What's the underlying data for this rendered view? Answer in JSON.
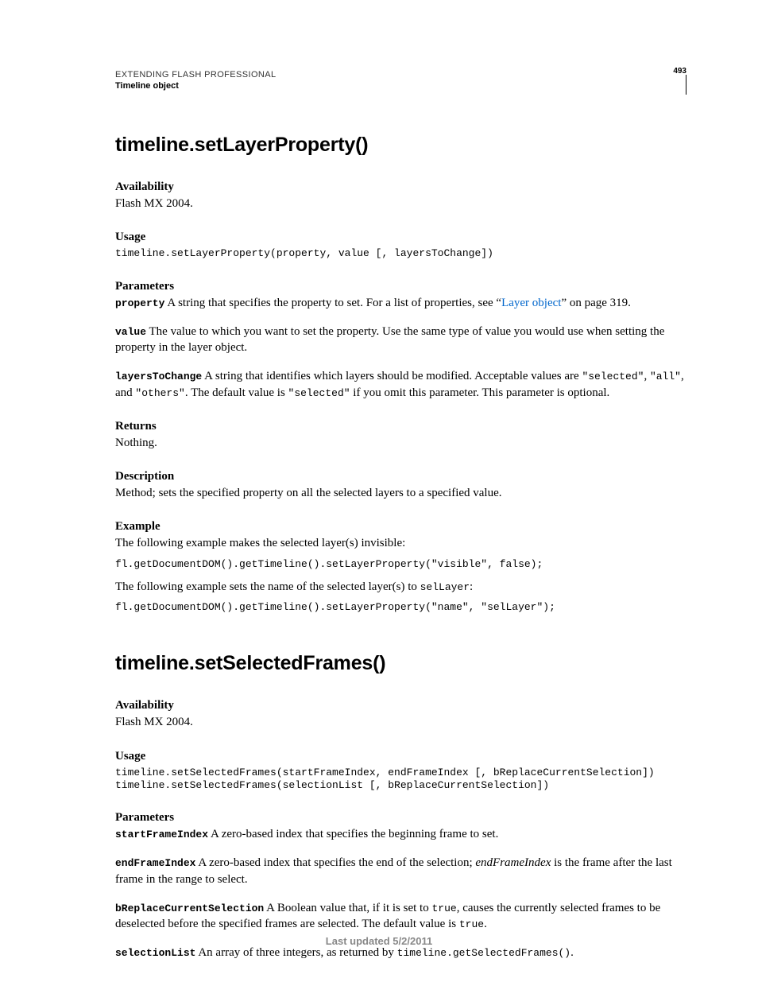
{
  "header": {
    "running1": "EXTENDING FLASH PROFESSIONAL",
    "running2": "Timeline object",
    "pageNumber": "493"
  },
  "s1": {
    "title": "timeline.setLayerProperty()",
    "availability_h": "Availability",
    "availability_t": "Flash MX 2004.",
    "usage_h": "Usage",
    "usage_code": "timeline.setLayerProperty(property, value [, layersToChange])",
    "parameters_h": "Parameters",
    "p1_name": "property",
    "p1_txt_a": "  A string that specifies the property to set. For a list of properties, see “",
    "p1_link": "Layer object",
    "p1_txt_b": "” on page 319.",
    "p2_name": "value",
    "p2_txt": "  The value to which you want to set the property. Use the same type of value you would use when setting the property in the layer object.",
    "p3_name": "layersToChange",
    "p3_txt_a": "  A string that identifies which layers should be modified. Acceptable values are ",
    "p3_c1": "\"selected\"",
    "p3_comma1": ", ",
    "p3_c2": "\"all\"",
    "p3_comma2": ", and ",
    "p3_c3": "\"others\"",
    "p3_txt_b": ". The default value is ",
    "p3_c4": "\"selected\"",
    "p3_txt_c": " if you omit this parameter. This parameter is optional.",
    "returns_h": "Returns",
    "returns_t": "Nothing.",
    "description_h": "Description",
    "description_t": "Method; sets the specified property on all the selected layers to a specified value.",
    "example_h": "Example",
    "example_intro1": "The following example makes the selected layer(s) invisible:",
    "example_code1": "fl.getDocumentDOM().getTimeline().setLayerProperty(\"visible\", false);",
    "example_intro2_a": "The following example sets the name of the selected layer(s) to ",
    "example_intro2_code": "selLayer",
    "example_intro2_b": ":",
    "example_code2": "fl.getDocumentDOM().getTimeline().setLayerProperty(\"name\", \"selLayer\");"
  },
  "s2": {
    "title": "timeline.setSelectedFrames()",
    "availability_h": "Availability",
    "availability_t": "Flash MX 2004.",
    "usage_h": "Usage",
    "usage_code": "timeline.setSelectedFrames(startFrameIndex, endFrameIndex [, bReplaceCurrentSelection])\ntimeline.setSelectedFrames(selectionList [, bReplaceCurrentSelection])",
    "parameters_h": "Parameters",
    "p1_name": "startFrameIndex",
    "p1_txt": "  A zero-based index that specifies the beginning frame to set.",
    "p2_name": "endFrameIndex",
    "p2_txt_a": "  A zero-based index that specifies the end of the selection; ",
    "p2_em": "endFrameIndex",
    "p2_txt_b": " is the frame after the last frame in the range to select.",
    "p3_name": "bReplaceCurrentSelection",
    "p3_txt_a": "  A Boolean value that, if it is set to ",
    "p3_c1": "true",
    "p3_txt_b": ", causes the currently selected frames to be deselected before the specified frames are selected. The default value is ",
    "p3_c2": "true",
    "p3_txt_c": ".",
    "p4_name": "selectionList",
    "p4_txt_a": "  An array of three integers, as returned by ",
    "p4_c1": "timeline.getSelectedFrames()",
    "p4_txt_b": "."
  },
  "footer": "Last updated 5/2/2011"
}
